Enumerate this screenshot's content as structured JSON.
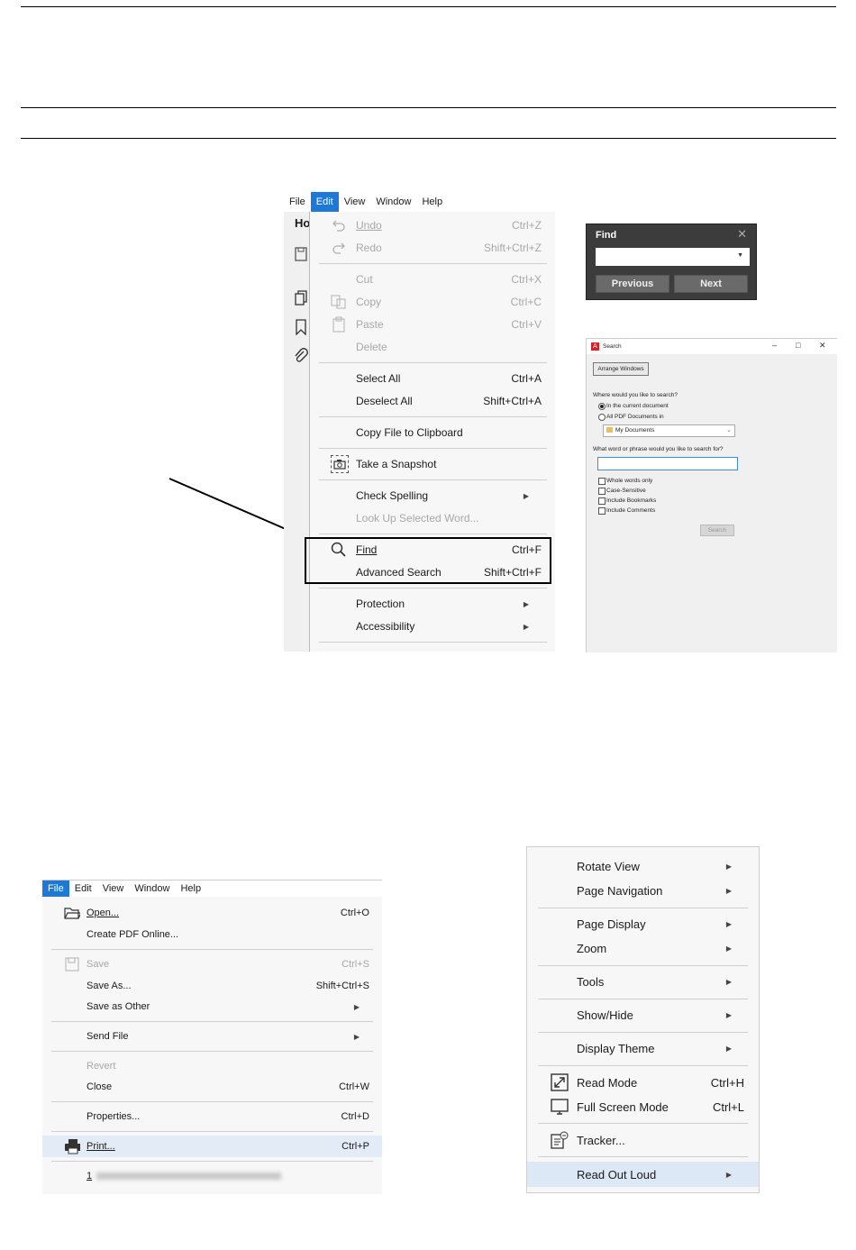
{
  "edit_screenshot": {
    "menubar": [
      "File",
      "Edit",
      "View",
      "Window",
      "Help"
    ],
    "sidebar_tab_fragment": "Ho",
    "items": {
      "undo": {
        "label": "Undo",
        "shortcut": "Ctrl+Z"
      },
      "redo": {
        "label": "Redo",
        "shortcut": "Shift+Ctrl+Z"
      },
      "cut": {
        "label": "Cut",
        "shortcut": "Ctrl+X"
      },
      "copy": {
        "label": "Copy",
        "shortcut": "Ctrl+C"
      },
      "paste": {
        "label": "Paste",
        "shortcut": "Ctrl+V"
      },
      "delete": {
        "label": "Delete"
      },
      "select_all": {
        "label": "Select All",
        "shortcut": "Ctrl+A"
      },
      "deselect_all": {
        "label": "Deselect All",
        "shortcut": "Shift+Ctrl+A"
      },
      "copy_file": {
        "label": "Copy File to Clipboard"
      },
      "snapshot": {
        "label": "Take a Snapshot"
      },
      "check_spelling": {
        "label": "Check Spelling"
      },
      "look_up": {
        "label": "Look Up Selected Word..."
      },
      "find": {
        "label": "Find",
        "shortcut": "Ctrl+F"
      },
      "advanced_search": {
        "label": "Advanced Search",
        "shortcut": "Shift+Ctrl+F"
      },
      "protection": {
        "label": "Protection"
      },
      "accessibility": {
        "label": "Accessibility"
      }
    }
  },
  "find_dialog": {
    "title": "Find",
    "previous": "Previous",
    "next": "Next"
  },
  "search_window": {
    "title": "Search",
    "arrange": "Arrange Windows",
    "where_label": "Where would you like to search?",
    "opt_current": "In the current document",
    "opt_all": "All PDF Documents in",
    "folder": "My Documents",
    "phrase_label": "What word or phrase would you like to search for?",
    "checks": [
      "Whole words only",
      "Case-Sensitive",
      "Include Bookmarks",
      "Include Comments"
    ],
    "search_button": "Search"
  },
  "file_screenshot": {
    "menubar": [
      "File",
      "Edit",
      "View",
      "Window",
      "Help"
    ],
    "items": {
      "open": {
        "label": "Open...",
        "shortcut": "Ctrl+O"
      },
      "create_pdf": {
        "label": "Create PDF Online..."
      },
      "save": {
        "label": "Save",
        "shortcut": "Ctrl+S"
      },
      "save_as": {
        "label": "Save As...",
        "shortcut": "Shift+Ctrl+S"
      },
      "save_other": {
        "label": "Save as Other"
      },
      "send_file": {
        "label": "Send File"
      },
      "revert": {
        "label": "Revert"
      },
      "close": {
        "label": "Close",
        "shortcut": "Ctrl+W"
      },
      "properties": {
        "label": "Properties...",
        "shortcut": "Ctrl+D"
      },
      "print": {
        "label": "Print...",
        "shortcut": "Ctrl+P"
      },
      "recent": {
        "label": "1"
      }
    }
  },
  "view_screenshot": {
    "items": {
      "rotate": {
        "label": "Rotate View"
      },
      "page_nav": {
        "label": "Page Navigation"
      },
      "page_display": {
        "label": "Page Display"
      },
      "zoom": {
        "label": "Zoom"
      },
      "tools": {
        "label": "Tools"
      },
      "show_hide": {
        "label": "Show/Hide"
      },
      "display_theme": {
        "label": "Display Theme"
      },
      "read_mode": {
        "label": "Read Mode",
        "shortcut": "Ctrl+H"
      },
      "full_screen": {
        "label": "Full Screen Mode",
        "shortcut": "Ctrl+L"
      },
      "tracker": {
        "label": "Tracker..."
      },
      "read_out_loud": {
        "label": "Read Out Loud"
      }
    }
  },
  "colors": {
    "accent": "#1e78d6",
    "disabled": "#a8a8a8",
    "dialog_dark": "#3c3c3c"
  }
}
